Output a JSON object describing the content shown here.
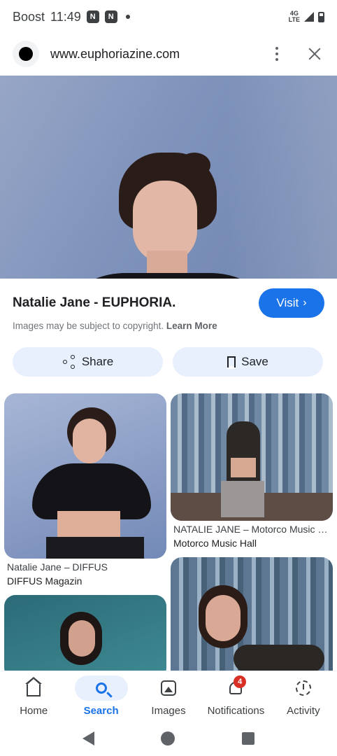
{
  "status_bar": {
    "carrier": "Boost",
    "time": "11:49",
    "network": "4G\nLTE"
  },
  "browser": {
    "url": "www.euphoriazine.com"
  },
  "result": {
    "title": "Natalie Jane - EUPHORIA.",
    "visit_label": "Visit",
    "copyright_text": "Images may be subject to copyright.",
    "learn_more": "Learn More",
    "share_label": "Share",
    "save_label": "Save"
  },
  "related": [
    {
      "title": "Natalie Jane – DIFFUS",
      "source": "DIFFUS Magazin"
    },
    {
      "title": "NATALIE JANE – Motorco Music Hall",
      "source": "Motorco Music Hall"
    }
  ],
  "bottom_nav": {
    "items": [
      {
        "label": "Home",
        "icon": "home-icon"
      },
      {
        "label": "Search",
        "icon": "search-icon"
      },
      {
        "label": "Images",
        "icon": "images-icon"
      },
      {
        "label": "Notifications",
        "icon": "bell-icon",
        "badge": "4"
      },
      {
        "label": "Activity",
        "icon": "activity-icon"
      }
    ]
  },
  "colors": {
    "accent": "#1a73e8",
    "chip_bg": "#e8f0fe",
    "badge": "#d93025"
  }
}
